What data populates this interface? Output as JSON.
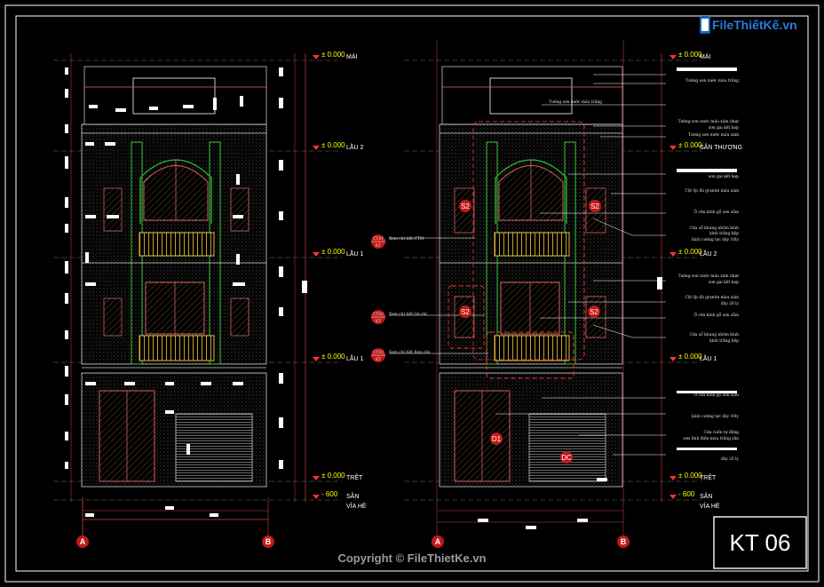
{
  "logo": {
    "brand": "FileThiếtKế.vn"
  },
  "copyright": "Copyright © FileThietKe.vn",
  "sheet_number": "KT 06",
  "levels_left": [
    {
      "value": "± 0.000",
      "name": "MÁI"
    },
    {
      "value": "± 0.000",
      "name": "LẦU 2"
    },
    {
      "value": "± 0.000",
      "name": "LẦU 1"
    },
    {
      "value": "± 0.000",
      "name": "LẦU 1"
    },
    {
      "value": "± 0.000",
      "name": "TRỆT"
    },
    {
      "value": "- 600",
      "name": "SÂN"
    },
    {
      "value": "",
      "name": "VỈA HÈ"
    }
  ],
  "levels_right": [
    {
      "value": "± 0.000",
      "name": "MÁI"
    },
    {
      "value": "± 0.000",
      "name": "SÂN THƯỢNG"
    },
    {
      "value": "± 0.000",
      "name": "LẦU 2"
    },
    {
      "value": "± 0.000",
      "name": "LẦU 1"
    },
    {
      "value": "± 0.000",
      "name": "TRỆT"
    },
    {
      "value": "- 600",
      "name": "SÂN"
    },
    {
      "value": "",
      "name": "VỈA HÈ"
    }
  ],
  "axes": {
    "a": "A",
    "b": "B"
  },
  "window_tags": [
    "S2",
    "S2",
    "S2",
    "S2",
    "D1",
    "DC"
  ],
  "detail_callouts": [
    {
      "top": "CT01",
      "bottom": "KT",
      "text": "Xem chi tiết CT01"
    },
    {
      "top": "CT02",
      "bottom": "KT",
      "text": "Xem chi tiết Gờ chỉ"
    },
    {
      "top": "CT03",
      "bottom": "KT",
      "text": "Xem chi tiết Ban côn"
    }
  ],
  "notes": [
    "Tường sơn nước màu trắng",
    "Tường sơn nước màu trắng",
    "Tường sơn nước màu xám nhạt",
    "sơn gai kết hợp",
    "Tường sơn nước màu xám",
    "sơn gai kết hợp",
    "Cột ốp đá granite màu xám",
    "Ô cửa kính gỗ sơn sẫm",
    "Cửa sổ khung nhôm kính",
    "kính trắng hộp",
    "kính cường lực dày 10ly",
    "Tường sơn nước màu xám nhạt",
    "sơn gai kết hợp",
    "Cột ốp đá granite màu xám",
    "dày 20 ly",
    "Ô cửa kính gỗ sơn sẫm",
    "Cửa sổ khung nhôm kính",
    "kính trắng hộp",
    "Ô cửa kính gỗ sơn sẫm",
    "kính cường lực dày 10ly",
    "Cửa cuốn tự động",
    "sơn tĩnh điện màu trắng sữa",
    "dày 20 ly"
  ]
}
